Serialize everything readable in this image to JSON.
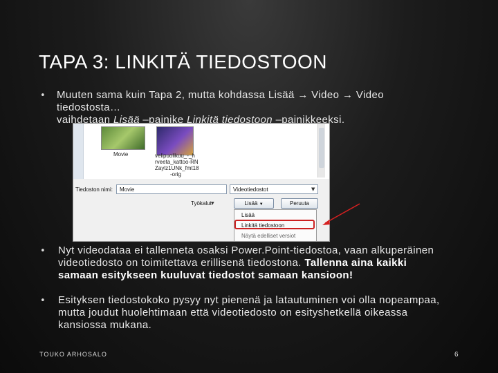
{
  "slide": {
    "title": "TAPA 3: LINKITÄ TIEDOSTOON",
    "bullet_glyph": "•",
    "bullet1": {
      "line1": "Muuten sama kuin Tapa 2, mutta kohdassa Lisää → Video → Video",
      "line2": "tiedostosta…",
      "line3_start": "vaihdetaan ",
      "line3_italic1": "Lisää",
      "line3_mid": " –painike ",
      "line3_italic2": "Linkitä tiedostoon",
      "line3_end": " –painikkeeksi."
    },
    "bullet2": {
      "line1": "Nyt videodataa ei tallenneta osaksi Power.Point-tiedostoa, vaan alkuperäinen",
      "line2_normal": "videotiedosto on toimitettava erillisenä tiedostona. ",
      "line2_bold": "Tallenna aina kaikki",
      "line3_bold": "samaan esitykseen kuuluvat tiedostot samaan kansioon!"
    },
    "bullet3": {
      "line1": "Esityksen tiedostokoko pysyy nyt pienenä ja latautuminen voi olla nopeampaa,",
      "line2": "mutta joudut huolehtimaan että videotiedosto on esityshetkellä oikeassa",
      "line3": "kansiossa mukana."
    },
    "footer": "TOUKO ARHOSALO",
    "page_number": "6"
  },
  "dialog": {
    "thumb1_label": "Movie",
    "thumb2_label_lines": [
      "velipuolikuu_-_h",
      "rveeta_kattoo-RN",
      "Zaylz1UNk_fmt18",
      "-orig"
    ],
    "filename_label": "Tiedoston nimi:",
    "filename_value": "Movie",
    "filetype_value": "Videotiedostot",
    "tools_label": "Työkalut",
    "insert_button": "Lisää",
    "cancel_button": "Peruuta",
    "menu_items": [
      "Lisää",
      "Linkitä tiedostoon",
      "Näytä edelliset versiot"
    ],
    "arrow_color": "#d62020",
    "highlight_color": "#cc2222"
  }
}
